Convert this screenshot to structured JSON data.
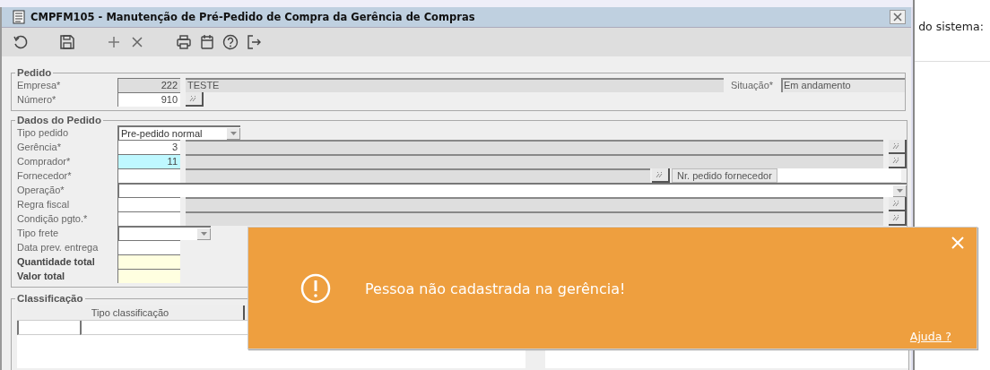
{
  "window": {
    "title": "CMPFM105 - Manutenção de Pré-Pedido de Compra da Gerência de Compras"
  },
  "pedido": {
    "title": "Pedido",
    "empresa": {
      "label": "Empresa*",
      "code": "222",
      "description": "TESTE"
    },
    "situacao": {
      "label": "Situação*",
      "value": "Em andamento"
    },
    "numero": {
      "label": "Número*",
      "value": "910"
    }
  },
  "dados": {
    "title": "Dados do Pedido",
    "rows": [
      {
        "kind": "select",
        "label": "Tipo pedido",
        "value": "Pre-pedido normal",
        "focused": false
      },
      {
        "kind": "lookup",
        "label": "Gerência*",
        "value": "3",
        "focused": false
      },
      {
        "kind": "lookup",
        "label": "Comprador*",
        "value": "11",
        "focused": true
      },
      {
        "kind": "supplier",
        "label": "Fornecedor*",
        "value": "",
        "button": "Nr. pedido fornecedor",
        "focused": false
      },
      {
        "kind": "wide_select",
        "label": "Operação*",
        "value": "",
        "focused": false
      },
      {
        "kind": "lookup",
        "label": "Regra fiscal",
        "value": "",
        "focused": false
      },
      {
        "kind": "lookup",
        "label": "Condição pgto.*",
        "value": "",
        "focused": false
      },
      {
        "kind": "small_select",
        "label": "Tipo frete",
        "value": "",
        "focused": false
      },
      {
        "kind": "input",
        "label": "Data prev. entrega",
        "value": "",
        "focused": false
      },
      {
        "kind": "total",
        "label": "Quantidade total",
        "value": "",
        "focused": false
      },
      {
        "kind": "total",
        "label": "Valor total",
        "value": "",
        "focused": false
      }
    ]
  },
  "classificacao": {
    "title": "Classificação",
    "columns": [
      "Tipo classificação"
    ]
  },
  "side_panel": {
    "text": "do sistema:"
  },
  "toast": {
    "message": "Pessoa não cadastrada na gerência!",
    "link": "Ajuda ?"
  }
}
